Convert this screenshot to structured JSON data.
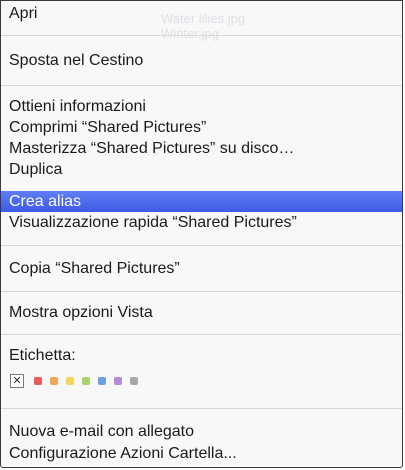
{
  "menu": {
    "items": [
      {
        "label": "Apri"
      },
      {
        "label": "Sposta nel Cestino"
      },
      {
        "label": "Ottieni informazioni"
      },
      {
        "label": "Comprimi “Shared Pictures”"
      },
      {
        "label": "Masterizza “Shared Pictures” su disco…"
      },
      {
        "label": "Duplica"
      },
      {
        "label": "Crea alias"
      },
      {
        "label": "Visualizzazione rapida “Shared Pictures”"
      },
      {
        "label": "Copia “Shared Pictures”"
      },
      {
        "label": "Mostra opzioni Vista"
      },
      {
        "label": "Etichetta:"
      },
      {
        "label": "Nuova e-mail con allegato"
      },
      {
        "label": "Configurazione Azioni Cartella..."
      }
    ],
    "highlighted_index": 6
  },
  "labels": {
    "none_symbol": "✕",
    "colors": [
      "#e85b5b",
      "#f2a65a",
      "#f1d65b",
      "#a9d46a",
      "#6ea0e6",
      "#b78ad9",
      "#a8a8a8"
    ]
  },
  "background_ghost": [
    "Water lilies.jpg",
    "Winter.jpg"
  ]
}
